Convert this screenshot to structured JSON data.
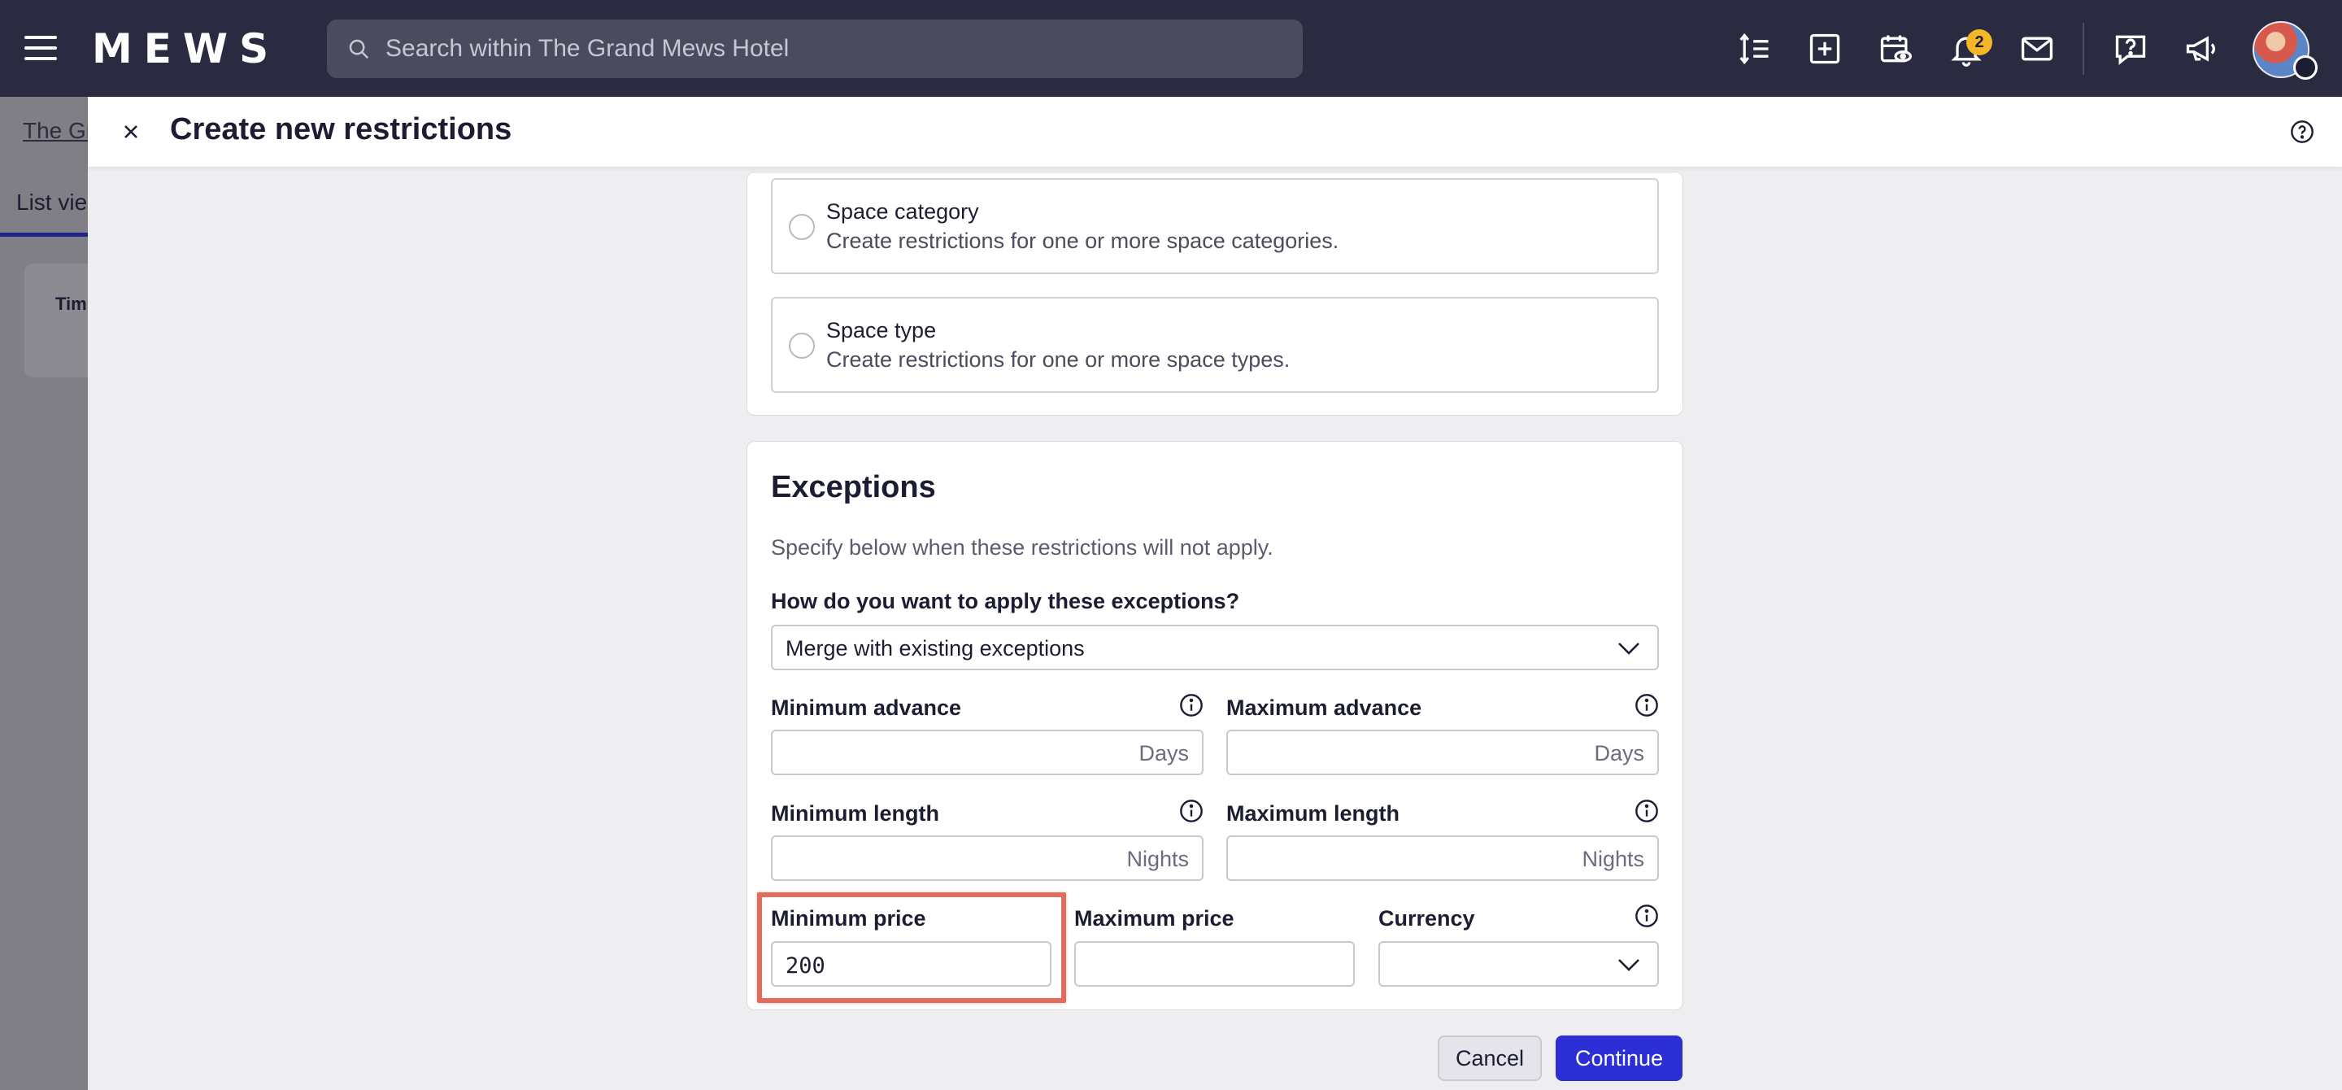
{
  "topbar": {
    "logo": "MEWS",
    "search_placeholder": "Search within The Grand Mews Hotel",
    "notification_count": "2"
  },
  "background": {
    "breadcrumb": "The Gr",
    "tab": "List vie",
    "column": "Tim"
  },
  "modal": {
    "title": "Create new restrictions",
    "options": [
      {
        "title": "Space category",
        "description": "Create restrictions for one or more space categories."
      },
      {
        "title": "Space type",
        "description": "Create restrictions for one or more space types."
      }
    ],
    "exceptions": {
      "title": "Exceptions",
      "description": "Specify below when these restrictions will not apply.",
      "apply_label": "How do you want to apply these exceptions?",
      "apply_value": "Merge with existing exceptions",
      "min_advance_label": "Minimum advance",
      "max_advance_label": "Maximum advance",
      "advance_unit": "Days",
      "min_length_label": "Minimum length",
      "max_length_label": "Maximum length",
      "length_unit": "Nights",
      "min_price_label": "Minimum price",
      "min_price_value": "200",
      "max_price_label": "Maximum price",
      "max_price_value": "",
      "currency_label": "Currency",
      "currency_value": ""
    },
    "buttons": {
      "cancel": "Cancel",
      "continue": "Continue"
    }
  },
  "colors": {
    "topbar": "#2a2b41",
    "primary": "#2d2fd6",
    "highlight": "#e36b5a",
    "badge": "#f5b728"
  }
}
